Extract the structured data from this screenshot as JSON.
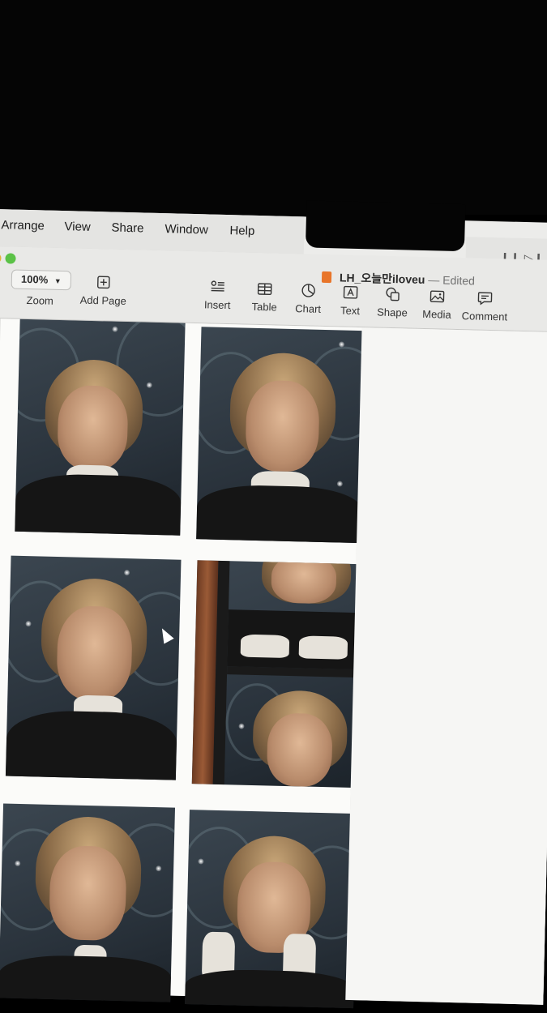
{
  "menubar": {
    "items": [
      "Arrange",
      "View",
      "Share",
      "Window",
      "Help"
    ]
  },
  "window": {
    "doc_name": "LH_오늘만iloveu",
    "separator": " — ",
    "doc_status": "Edited"
  },
  "toolbar": {
    "zoom_value": "100%",
    "zoom_label": "Zoom",
    "add_page_label": "Add Page",
    "insert_label": "Insert",
    "table_label": "Table",
    "chart_label": "Chart",
    "text_label": "Text",
    "shape_label": "Shape",
    "media_label": "Media",
    "comment_label": "Comment"
  },
  "colors": {
    "close_light": "#ec5f5a",
    "minimize_light": "#e3b53c",
    "zoom_light": "#5bc247"
  }
}
